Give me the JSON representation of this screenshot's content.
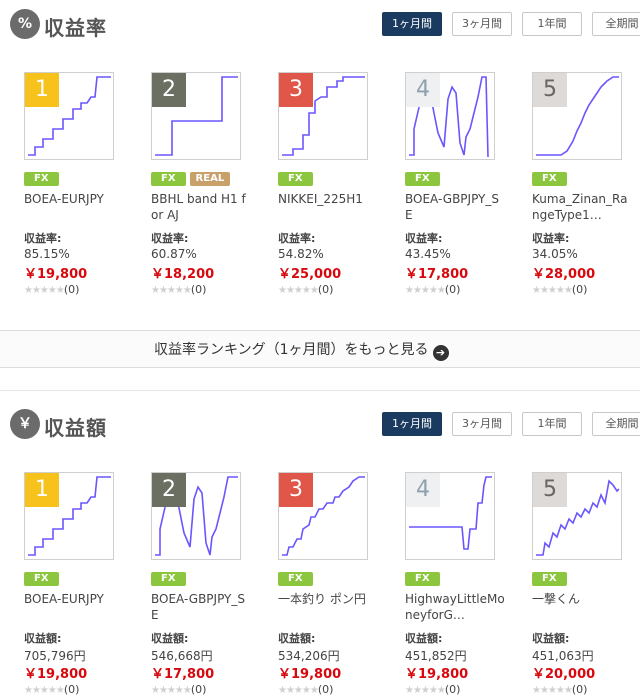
{
  "colors": {
    "accent": "#1b3a5f",
    "price": "#d8090e",
    "fx_badge": "#8cc63f",
    "real_badge": "#c8a06a",
    "line": "#6a56ff"
  },
  "rate_section": {
    "icon": "%",
    "title": "収益率",
    "tabs": [
      "1ヶ月間",
      "3ヶ月間",
      "1年間",
      "全期間"
    ],
    "active_tab": "1ヶ月間",
    "metric_label": "収益率:",
    "cards": [
      {
        "rank": "1",
        "badges": [
          "FX"
        ],
        "name": "BOEA-EURJPY",
        "metric": "85.15%",
        "price": "￥19,800",
        "rating": "(0)"
      },
      {
        "rank": "2",
        "badges": [
          "FX",
          "REAL"
        ],
        "name": "BBHL band H1 for AJ",
        "metric": "60.87%",
        "price": "￥18,200",
        "rating": "(0)"
      },
      {
        "rank": "3",
        "badges": [
          "FX"
        ],
        "name": "NIKKEI_225H1",
        "metric": "54.82%",
        "price": "￥25,000",
        "rating": "(0)"
      },
      {
        "rank": "4",
        "badges": [
          "FX"
        ],
        "name": "BOEA-GBPJPY_SE",
        "metric": "43.45%",
        "price": "￥17,800",
        "rating": "(0)"
      },
      {
        "rank": "5",
        "badges": [
          "FX"
        ],
        "name": "Kuma_Zinan_RangeType1…",
        "metric": "34.05%",
        "price": "￥28,000",
        "rating": "(0)"
      }
    ],
    "more_link": "収益率ランキング（1ヶ月間）をもっと見る"
  },
  "amount_section": {
    "icon": "￥",
    "title": "収益額",
    "tabs": [
      "1ヶ月間",
      "3ヶ月間",
      "1年間",
      "全期間"
    ],
    "active_tab": "1ヶ月間",
    "metric_label": "収益額:",
    "cards": [
      {
        "rank": "1",
        "badges": [
          "FX"
        ],
        "name": "BOEA-EURJPY",
        "metric": "705,796円",
        "price": "￥19,800",
        "rating": "(0)"
      },
      {
        "rank": "2",
        "badges": [
          "FX"
        ],
        "name": "BOEA-GBPJPY_SE",
        "metric": "546,668円",
        "price": "￥17,800",
        "rating": "(0)"
      },
      {
        "rank": "3",
        "badges": [
          "FX"
        ],
        "name": "一本釣り ポン円",
        "metric": "534,206円",
        "price": "￥19,800",
        "rating": "(0)"
      },
      {
        "rank": "4",
        "badges": [
          "FX"
        ],
        "name": "HighwayLittleMoneyforG…",
        "metric": "451,852円",
        "price": "￥19,800",
        "rating": "(0)"
      },
      {
        "rank": "5",
        "badges": [
          "FX"
        ],
        "name": "一撃くん",
        "metric": "451,063円",
        "price": "￥20,000",
        "rating": "(0)"
      }
    ]
  }
}
